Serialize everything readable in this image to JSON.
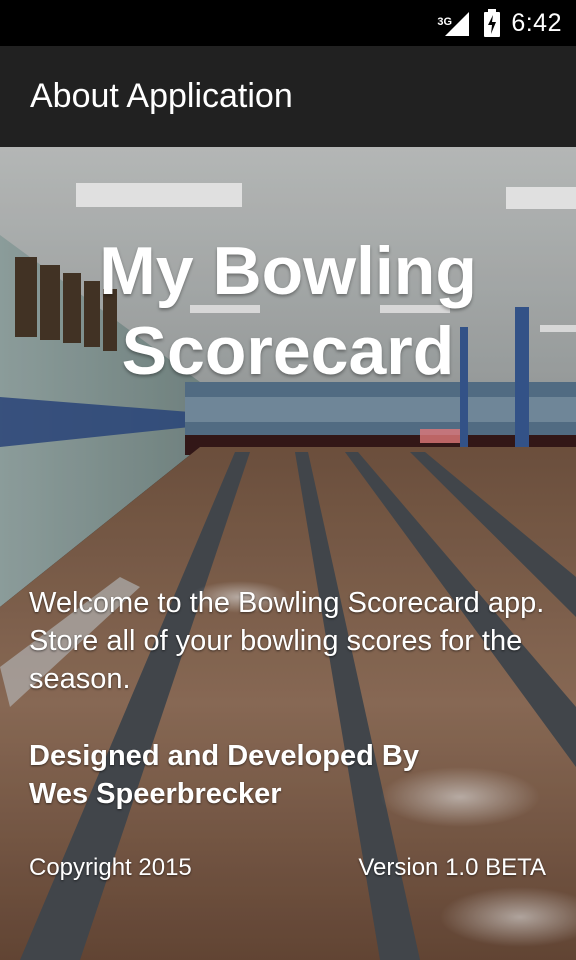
{
  "status_bar": {
    "network_label": "3G",
    "time": "6:42",
    "icons": [
      "signal-icon",
      "battery-charging-icon"
    ]
  },
  "app_bar": {
    "title": "About Application"
  },
  "hero": {
    "title_line1": "My Bowling",
    "title_line2": "Scorecard",
    "background": "bowling-alley-photo"
  },
  "content": {
    "welcome_text": "Welcome to the Bowling Scorecard app. Store all of your bowling scores for the season.",
    "designed_line1": "Designed and Developed By",
    "designed_line2": "Wes Speerbrecker",
    "copyright": "Copyright 2015",
    "version": "Version 1.0 BETA"
  },
  "colors": {
    "status_bar": "#000000",
    "app_bar": "#212121",
    "text": "#ffffff"
  }
}
